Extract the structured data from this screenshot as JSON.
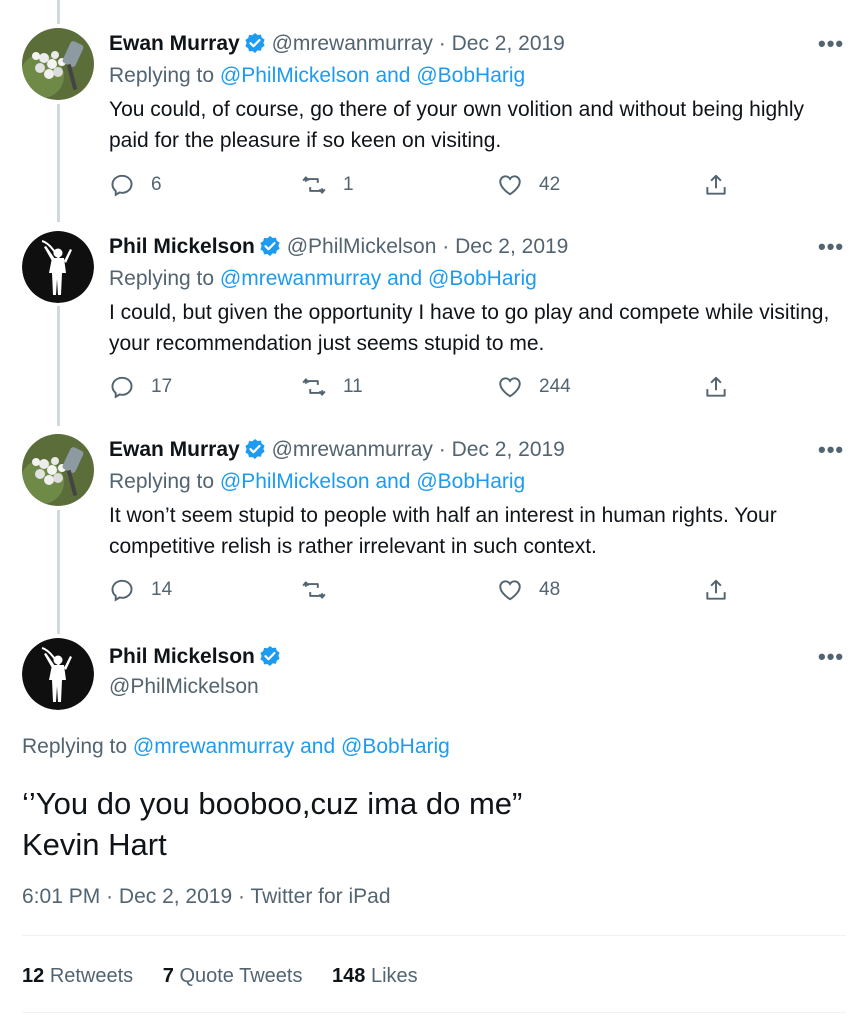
{
  "replies": [
    {
      "name": "Ewan Murray",
      "handle": "@mrewanmurray",
      "sep": "·",
      "date": "Dec 2, 2019",
      "replying_prefix": "Replying to",
      "replying_to_1": "@PhilMickelson",
      "replying_and": "and",
      "replying_to_2": "@BobHarig",
      "text": "You could, of course, go there of your own volition and without being highly paid for the pleasure if so keen on visiting.",
      "reply_count": "6",
      "retweet_count": "1",
      "like_count": "42",
      "more": "•••"
    },
    {
      "name": "Phil Mickelson",
      "handle": "@PhilMickelson",
      "sep": "·",
      "date": "Dec 2, 2019",
      "replying_prefix": "Replying to",
      "replying_to_1": "@mrewanmurray",
      "replying_and": "and",
      "replying_to_2": "@BobHarig",
      "text": "I could, but given the opportunity I have to go play and compete while visiting, your recommendation just seems stupid to me.",
      "reply_count": "17",
      "retweet_count": "11",
      "like_count": "244",
      "more": "•••"
    },
    {
      "name": "Ewan Murray",
      "handle": "@mrewanmurray",
      "sep": "·",
      "date": "Dec 2, 2019",
      "replying_prefix": "Replying to",
      "replying_to_1": "@PhilMickelson",
      "replying_and": "and",
      "replying_to_2": "@BobHarig",
      "text": "It won’t seem stupid to people with half an interest in human rights. Your competitive relish is rather irrelevant in such context.",
      "reply_count": "14",
      "retweet_count": "",
      "like_count": "48",
      "more": "•••"
    }
  ],
  "main": {
    "name": "Phil Mickelson",
    "handle": "@PhilMickelson",
    "more": "•••",
    "replying_prefix": "Replying to",
    "replying_to_1": "@mrewanmurray",
    "replying_and": "and",
    "replying_to_2": "@BobHarig",
    "text_line1": "‘’You do you booboo,cuz ima do me”",
    "text_line2": "Kevin Hart",
    "time": "6:01 PM",
    "sep": "·",
    "date": "Dec 2, 2019",
    "source": "Twitter for iPad",
    "retweets_count": "12",
    "retweets_label": "Retweets",
    "quotes_count": "7",
    "quotes_label": "Quote Tweets",
    "likes_count": "148",
    "likes_label": "Likes"
  },
  "colors": {
    "accent": "#1d9bf0",
    "secondary_text": "#536471",
    "primary_text": "#0f1419",
    "thread_line": "#cfd9de"
  },
  "icons": {
    "verified": "verified-badge-icon",
    "reply": "reply-icon",
    "retweet": "retweet-icon",
    "like": "heart-icon",
    "share": "share-icon",
    "more": "more-icon"
  }
}
